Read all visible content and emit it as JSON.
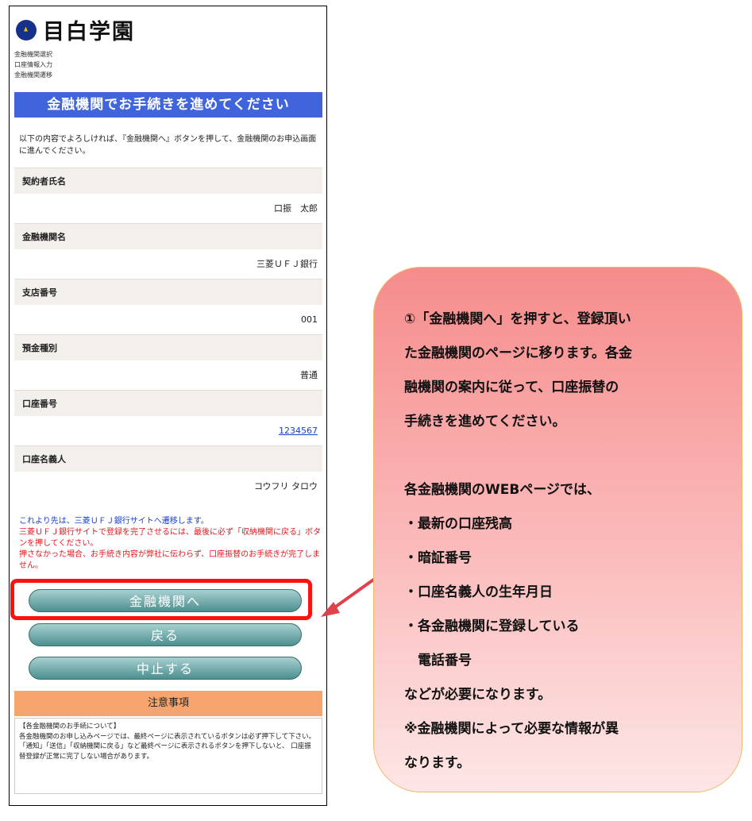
{
  "logo": {
    "name": "目白学園"
  },
  "steps": [
    "金融機関選択",
    "口座情報入力",
    "金融機関遷移"
  ],
  "page_title": "金融機関でお手続きを進めてください",
  "intro": "以下の内容でよろしければ、『金融機関へ』ボタンを押して、金融機関のお申込画面に進んでください。",
  "fields": [
    {
      "label": "契約者氏名",
      "value": "口振　太郎"
    },
    {
      "label": "金融機関名",
      "value": "三菱ＵＦＪ銀行"
    },
    {
      "label": "支店番号",
      "value": "001"
    },
    {
      "label": "預金種別",
      "value": "普通"
    },
    {
      "label": "口座番号",
      "value": "1234567"
    },
    {
      "label": "口座名義人",
      "value": "コウフリ タロウ"
    }
  ],
  "notice": {
    "blue": "これより先は、三菱ＵＦＪ銀行サイトへ遷移します。",
    "red1": "三菱ＵＦＪ銀行サイトで登録を完了させるには、最後に必ず「収納機関に戻る」ボタンを押してください。",
    "red2": "押さなかった場合、お手続き内容が弊社に伝わらず、口座振替のお手続きが完了しません。"
  },
  "buttons": {
    "proceed": "金融機関へ",
    "back": "戻る",
    "cancel": "中止する"
  },
  "caution": {
    "title": "注意事項",
    "heading": "【各金融機関のお手続について】",
    "body": "各金融機関のお申し込みページでは、最終ページに表示されているボタンは必ず押下して下さい。「通知」「送信」「収納機関に戻る」など最終ページに表示されるボタンを押下しないと、 口座振替登録が正常に完了しない場合があります。"
  },
  "callout": {
    "lines": [
      "①「金融機関へ」を押すと、登録頂い",
      "た金融機関のページに移ります。各金",
      "融機関の案内に従って、口座振替の",
      "手続きを進めてください。",
      "",
      "各金融機関のWEBページでは、",
      "・最新の口座残高",
      "・暗証番号",
      "・口座名義人の生年月日",
      "・各金融機関に登録している",
      "　電話番号",
      "などが必要になります。",
      "※金融機関によって必要な情報が異",
      "なります。"
    ]
  },
  "colors": {
    "title_bar": "#3f64dc",
    "caution_head": "#f7a46e",
    "highlight": "#ff1111",
    "link": "#1a3fcf",
    "warning": "#e0191e"
  }
}
